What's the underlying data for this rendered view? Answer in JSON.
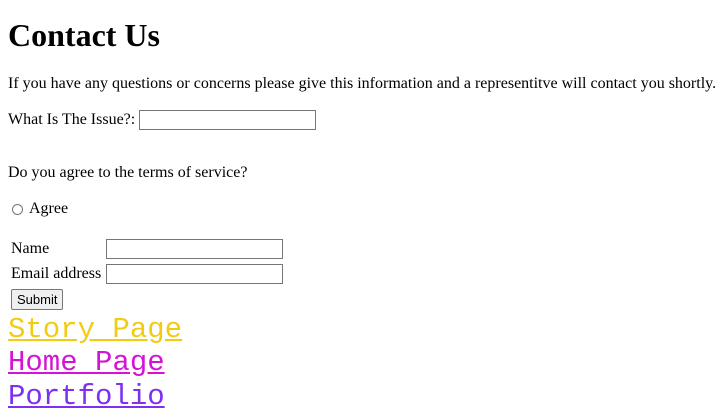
{
  "page": {
    "title": "Contact Us",
    "intro": "If you have any questions or concerns please give this information and a representitve will contact you shortly."
  },
  "issue": {
    "label": "What Is The Issue?:",
    "value": "",
    "placeholder": ""
  },
  "terms": {
    "question": "Do you agree to the terms of service?",
    "agree_label": "Agree",
    "agree_checked": false
  },
  "form": {
    "name_label": "Name",
    "name_value": "",
    "email_label": "Email address",
    "email_value": "",
    "submit_label": "Submit"
  },
  "nav": {
    "links": [
      {
        "label": "Story Page",
        "color": "#f2cc14"
      },
      {
        "label": "Home Page",
        "color": "#d414d4"
      },
      {
        "label": "Portfolio",
        "color": "#7d2ff2"
      }
    ]
  }
}
